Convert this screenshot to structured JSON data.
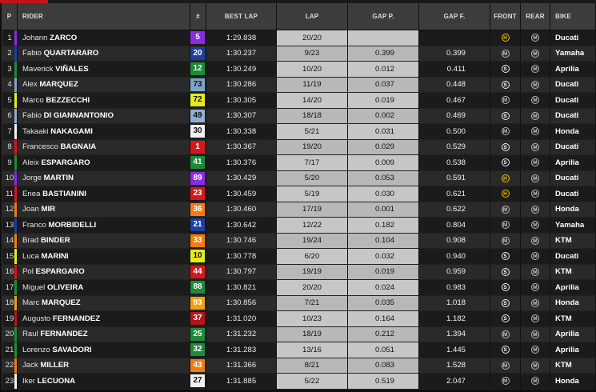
{
  "headers": {
    "pos": "P",
    "rider": "RIDER",
    "number": "#",
    "best_lap": "BEST LAP",
    "lap": "LAP",
    "gap_prev": "GAP P.",
    "gap_first": "GAP F.",
    "front": "FRONT",
    "rear": "REAR",
    "bike": "BIKE"
  },
  "rows": [
    {
      "pos": "1",
      "first": "Johann",
      "last": "ZARCO",
      "num": "5",
      "num_bg": "#8a2be2",
      "num_fg": "#ffffff",
      "bar": "#8a2be2",
      "best": "1:29.838",
      "lap": "20/20",
      "gap_p": "",
      "gap_f": "",
      "front": "H",
      "rear": "M",
      "bike": "Ducati"
    },
    {
      "pos": "2",
      "first": "Fabio",
      "last": "QUARTARARO",
      "num": "20",
      "num_bg": "#1d3fa0",
      "num_fg": "#ffffff",
      "bar": "#1d3fa0",
      "best": "1:30.237",
      "lap": "9/23",
      "gap_p": "0.399",
      "gap_f": "0.399",
      "front": "M",
      "rear": "M",
      "bike": "Yamaha"
    },
    {
      "pos": "3",
      "first": "Maverick",
      "last": "VIÑALES",
      "num": "12",
      "num_bg": "#1d8a3a",
      "num_fg": "#ffffff",
      "bar": "#1d8a3a",
      "best": "1:30.249",
      "lap": "10/20",
      "gap_p": "0.012",
      "gap_f": "0.411",
      "front": "S",
      "rear": "M",
      "bike": "Aprilia"
    },
    {
      "pos": "4",
      "first": "Alex",
      "last": "MARQUEZ",
      "num": "73",
      "num_bg": "#7fa3c8",
      "num_fg": "#111111",
      "bar": "#7fa3c8",
      "best": "1:30.286",
      "lap": "11/19",
      "gap_p": "0.037",
      "gap_f": "0.448",
      "front": "S",
      "rear": "M",
      "bike": "Ducati"
    },
    {
      "pos": "5",
      "first": "Marco",
      "last": "BEZZECCHI",
      "num": "72",
      "num_bg": "#e6ec18",
      "num_fg": "#111111",
      "bar": "#e6ec18",
      "best": "1:30.305",
      "lap": "14/20",
      "gap_p": "0.019",
      "gap_f": "0.467",
      "front": "M",
      "rear": "M",
      "bike": "Ducati"
    },
    {
      "pos": "6",
      "first": "Fabio",
      "last": "DI GIANNANTONIO",
      "num": "49",
      "num_bg": "#8fb0d4",
      "num_fg": "#111111",
      "bar": "#8fb0d4",
      "best": "1:30.307",
      "lap": "18/18",
      "gap_p": "0.002",
      "gap_f": "0.469",
      "front": "S",
      "rear": "M",
      "bike": "Ducati"
    },
    {
      "pos": "7",
      "first": "Takaaki",
      "last": "NAKAGAMI",
      "num": "30",
      "num_bg": "#f2f2f2",
      "num_fg": "#111111",
      "bar": "#f2f2f2",
      "best": "1:30.338",
      "lap": "5/21",
      "gap_p": "0.031",
      "gap_f": "0.500",
      "front": "M",
      "rear": "M",
      "bike": "Honda"
    },
    {
      "pos": "8",
      "first": "Francesco",
      "last": "BAGNAIA",
      "num": "1",
      "num_bg": "#d8161c",
      "num_fg": "#ffffff",
      "bar": "#d8161c",
      "best": "1:30.367",
      "lap": "19/20",
      "gap_p": "0.029",
      "gap_f": "0.529",
      "front": "S",
      "rear": "M",
      "bike": "Ducati"
    },
    {
      "pos": "9",
      "first": "Aleix",
      "last": "ESPARGARO",
      "num": "41",
      "num_bg": "#1d8a3a",
      "num_fg": "#ffffff",
      "bar": "#1d8a3a",
      "best": "1:30.376",
      "lap": "7/17",
      "gap_p": "0.009",
      "gap_f": "0.538",
      "front": "S",
      "rear": "M",
      "bike": "Aprilia"
    },
    {
      "pos": "10",
      "first": "Jorge",
      "last": "MARTIN",
      "num": "89",
      "num_bg": "#8a2be2",
      "num_fg": "#ffffff",
      "bar": "#8a2be2",
      "best": "1:30.429",
      "lap": "5/20",
      "gap_p": "0.053",
      "gap_f": "0.591",
      "front": "H",
      "rear": "M",
      "bike": "Ducati"
    },
    {
      "pos": "11",
      "first": "Enea",
      "last": "BASTIANINI",
      "num": "23",
      "num_bg": "#d8161c",
      "num_fg": "#ffffff",
      "bar": "#d8161c",
      "best": "1:30.459",
      "lap": "5/19",
      "gap_p": "0.030",
      "gap_f": "0.621",
      "front": "H",
      "rear": "M",
      "bike": "Ducati"
    },
    {
      "pos": "12",
      "first": "Joan",
      "last": "MIR",
      "num": "36",
      "num_bg": "#f07c12",
      "num_fg": "#ffffff",
      "bar": "#f07c12",
      "best": "1:30.460",
      "lap": "17/19",
      "gap_p": "0.001",
      "gap_f": "0.622",
      "front": "M",
      "rear": "M",
      "bike": "Honda"
    },
    {
      "pos": "13",
      "first": "Franco",
      "last": "MORBIDELLI",
      "num": "21",
      "num_bg": "#1d3fa0",
      "num_fg": "#ffffff",
      "bar": "#1d3fa0",
      "best": "1:30.642",
      "lap": "12/22",
      "gap_p": "0.182",
      "gap_f": "0.804",
      "front": "M",
      "rear": "M",
      "bike": "Yamaha"
    },
    {
      "pos": "14",
      "first": "Brad",
      "last": "BINDER",
      "num": "33",
      "num_bg": "#f07c12",
      "num_fg": "#ffffff",
      "bar": "#f07c12",
      "best": "1:30.746",
      "lap": "19/24",
      "gap_p": "0.104",
      "gap_f": "0.908",
      "front": "M",
      "rear": "M",
      "bike": "KTM"
    },
    {
      "pos": "15",
      "first": "Luca",
      "last": "MARINI",
      "num": "10",
      "num_bg": "#e6ec18",
      "num_fg": "#111111",
      "bar": "#e6ec18",
      "best": "1:30.778",
      "lap": "6/20",
      "gap_p": "0.032",
      "gap_f": "0.940",
      "front": "S",
      "rear": "M",
      "bike": "Ducati"
    },
    {
      "pos": "16",
      "first": "Pol",
      "last": "ESPARGARO",
      "num": "44",
      "num_bg": "#d8161c",
      "num_fg": "#ffffff",
      "bar": "#d8161c",
      "best": "1:30.797",
      "lap": "19/19",
      "gap_p": "0.019",
      "gap_f": "0.959",
      "front": "S",
      "rear": "M",
      "bike": "KTM"
    },
    {
      "pos": "17",
      "first": "Miguel",
      "last": "OLIVEIRA",
      "num": "88",
      "num_bg": "#1d8a3a",
      "num_fg": "#ffffff",
      "bar": "#1d8a3a",
      "best": "1:30.821",
      "lap": "20/20",
      "gap_p": "0.024",
      "gap_f": "0.983",
      "front": "S",
      "rear": "M",
      "bike": "Aprilia"
    },
    {
      "pos": "18",
      "first": "Marc",
      "last": "MARQUEZ",
      "num": "93",
      "num_bg": "#f0a010",
      "num_fg": "#ffffff",
      "bar": "#f0a010",
      "best": "1:30.856",
      "lap": "7/21",
      "gap_p": "0.035",
      "gap_f": "1.018",
      "front": "S",
      "rear": "M",
      "bike": "Honda"
    },
    {
      "pos": "19",
      "first": "Augusto",
      "last": "FERNANDEZ",
      "num": "37",
      "num_bg": "#b0161c",
      "num_fg": "#ffffff",
      "bar": "#b0161c",
      "best": "1:31.020",
      "lap": "10/23",
      "gap_p": "0.164",
      "gap_f": "1.182",
      "front": "S",
      "rear": "M",
      "bike": "KTM"
    },
    {
      "pos": "20",
      "first": "Raul",
      "last": "FERNANDEZ",
      "num": "25",
      "num_bg": "#1d8a3a",
      "num_fg": "#ffffff",
      "bar": "#1d8a3a",
      "best": "1:31.232",
      "lap": "18/19",
      "gap_p": "0.212",
      "gap_f": "1.394",
      "front": "M",
      "rear": "M",
      "bike": "Aprilia"
    },
    {
      "pos": "21",
      "first": "Lorenzo",
      "last": "SAVADORI",
      "num": "32",
      "num_bg": "#1d8a3a",
      "num_fg": "#ffffff",
      "bar": "#1d8a3a",
      "best": "1:31.283",
      "lap": "13/16",
      "gap_p": "0.051",
      "gap_f": "1.445",
      "front": "S",
      "rear": "M",
      "bike": "Aprilia"
    },
    {
      "pos": "22",
      "first": "Jack",
      "last": "MILLER",
      "num": "43",
      "num_bg": "#f07c12",
      "num_fg": "#ffffff",
      "bar": "#f07c12",
      "best": "1:31.366",
      "lap": "8/21",
      "gap_p": "0.083",
      "gap_f": "1.528",
      "front": "M",
      "rear": "M",
      "bike": "KTM"
    },
    {
      "pos": "23",
      "first": "Iker",
      "last": "LECUONA",
      "num": "27",
      "num_bg": "#f2f2f2",
      "num_fg": "#111111",
      "bar": "#f2f2f2",
      "best": "1:31.885",
      "lap": "5/22",
      "gap_p": "0.519",
      "gap_f": "2.047",
      "front": "M",
      "rear": "M",
      "bike": "Honda"
    }
  ]
}
